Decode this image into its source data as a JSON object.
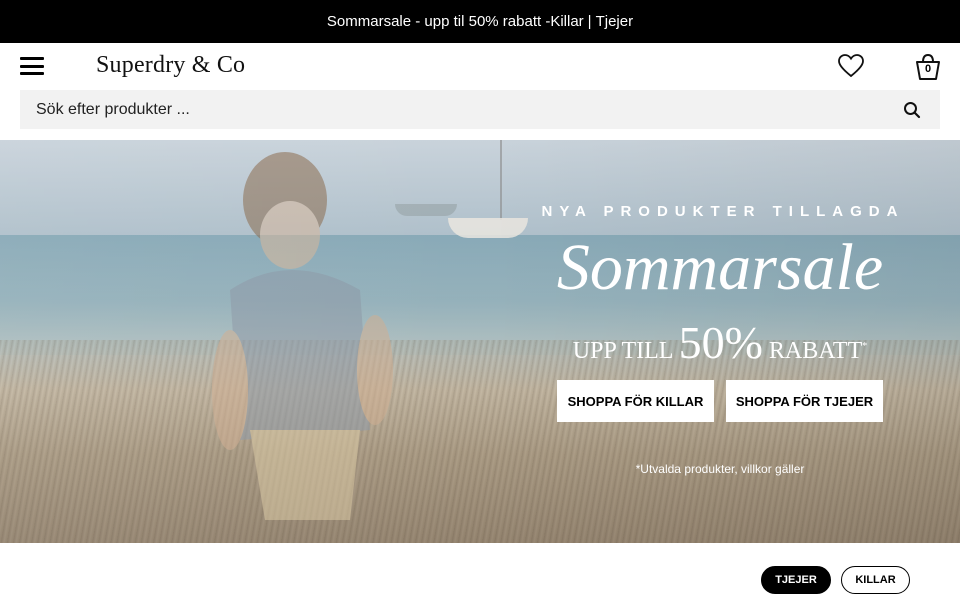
{
  "promo": {
    "text": "Sommarsale - upp til 50% rabatt - ",
    "link_men": "Killar",
    "separator": "|",
    "link_women": "Tjejer"
  },
  "header": {
    "logo": "Superdry & Co",
    "bag_count": "0"
  },
  "search": {
    "placeholder": "Sök efter produkter ..."
  },
  "hero": {
    "kicker": "NYA PRODUKTER TILLAGDA",
    "headline": "Sommarsale",
    "discount_prefix": "UPP TILL",
    "discount_value": "50%",
    "discount_suffix": "RABATT",
    "discount_mark": "*",
    "button_men": "SHOPPA FÖR KILLAR",
    "button_women": "SHOPPA FÖR TJEJER",
    "terms": "*Utvalda produkter, villkor gäller"
  },
  "gender_toggle": {
    "women": "TJEJER",
    "men": "KILLAR"
  },
  "colors": {
    "promo_bg": "#000000",
    "search_bg": "#f2f2f2",
    "pill_active": "#000000"
  },
  "icons": {
    "menu": "hamburger-menu-icon",
    "wishlist": "heart-icon",
    "bag": "shopping-bag-icon",
    "search": "search-icon"
  }
}
